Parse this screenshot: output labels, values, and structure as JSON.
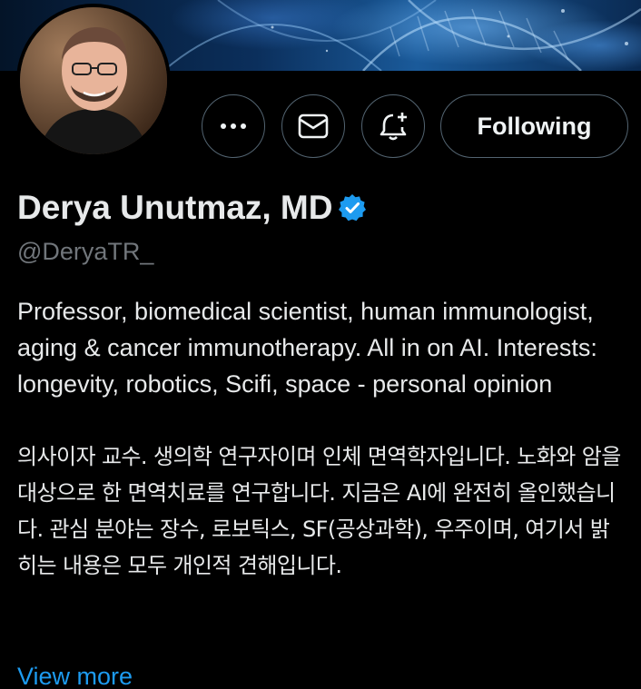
{
  "profile": {
    "display_name": "Derya Unutmaz, MD",
    "handle": "@DeryaTR_",
    "verified": true,
    "bio_english": "Professor, biomedical scientist, human immunologist, aging & cancer immunotherapy. All in on AI. Interests: longevity, robotics, Scifi, space - personal opinion",
    "bio_korean": "의사이자 교수. 생의학 연구자이며 인체 면역학자입니다. 노화와 암을 대상으로 한 면역치료를 연구합니다. 지금은 AI에 완전히 올인했습니다. 관심 분야는 장수, 로보틱스, SF(공상과학), 우주이며, 여기서 밝히는 내용은 모두 개인적 견해입니다.",
    "view_more_label": "View more"
  },
  "actions": {
    "more_icon": "ellipsis-icon",
    "message_icon": "envelope-icon",
    "notify_icon": "bell-plus-icon",
    "following_label": "Following"
  },
  "colors": {
    "background": "#000000",
    "primary_text": "#e7e9ea",
    "secondary_text": "#71767b",
    "accent": "#1d9bf0",
    "button_border": "#536471"
  }
}
